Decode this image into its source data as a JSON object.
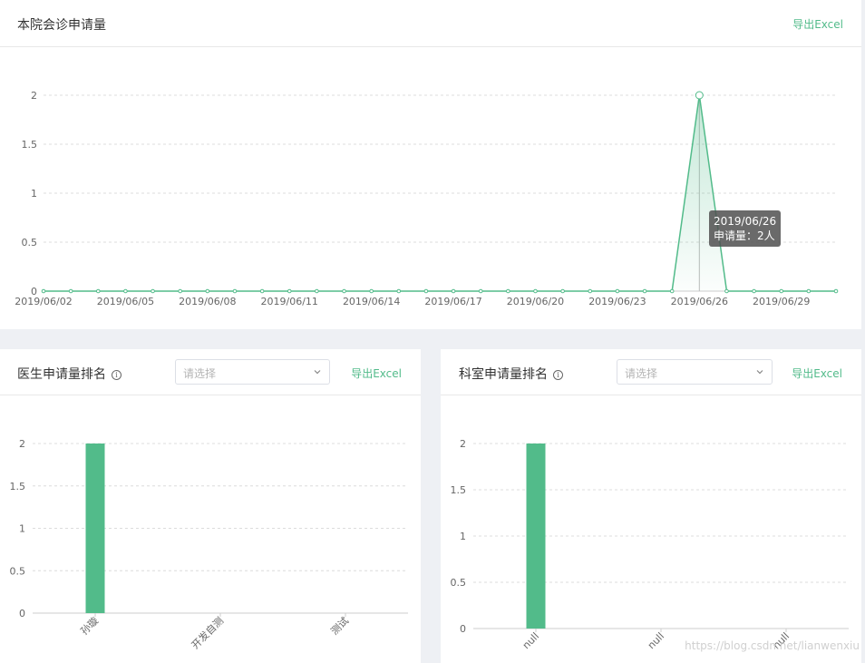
{
  "top": {
    "title": "本院会诊申请量",
    "export_label": "导出Excel",
    "tooltip": {
      "date": "2019/06/26",
      "line": "申请量：2人"
    }
  },
  "doctor": {
    "title": "医生申请量排名",
    "info_icon": "info-circle-icon",
    "select_placeholder": "请选择",
    "export_label": "导出Excel"
  },
  "dept": {
    "title": "科室申请量排名",
    "info_icon": "info-circle-icon",
    "select_placeholder": "请选择",
    "export_label": "导出Excel"
  },
  "watermark": "https://blog.csdn.net/lianwenxiu",
  "colors": {
    "accent": "#52bb8a",
    "bar": "#52bb8a"
  },
  "chart_data": [
    {
      "type": "area",
      "x": [
        "2019/06/02",
        "2019/06/03",
        "2019/06/04",
        "2019/06/05",
        "2019/06/06",
        "2019/06/07",
        "2019/06/08",
        "2019/06/09",
        "2019/06/10",
        "2019/06/11",
        "2019/06/12",
        "2019/06/13",
        "2019/06/14",
        "2019/06/15",
        "2019/06/16",
        "2019/06/17",
        "2019/06/18",
        "2019/06/19",
        "2019/06/20",
        "2019/06/21",
        "2019/06/22",
        "2019/06/23",
        "2019/06/24",
        "2019/06/25",
        "2019/06/26",
        "2019/06/27",
        "2019/06/28",
        "2019/06/29",
        "2019/06/30",
        "2019/07/01"
      ],
      "x_tick_labels": [
        "2019/06/02",
        "2019/06/05",
        "2019/06/08",
        "2019/06/11",
        "2019/06/14",
        "2019/06/17",
        "2019/06/20",
        "2019/06/23",
        "2019/06/26",
        "2019/06/29"
      ],
      "series": [
        {
          "values": [
            0,
            0,
            0,
            0,
            0,
            0,
            0,
            0,
            0,
            0,
            0,
            0,
            0,
            0,
            0,
            0,
            0,
            0,
            0,
            0,
            0,
            0,
            0,
            0,
            2,
            0,
            0,
            0,
            0,
            0
          ]
        }
      ],
      "y_ticks": [
        "0",
        "0.5",
        "1",
        "1.5",
        "2"
      ],
      "ylim": [
        0,
        2
      ],
      "grid": true
    },
    {
      "type": "bar",
      "categories": [
        "孙璇",
        "开发自测",
        "测试"
      ],
      "values": [
        2,
        0,
        0
      ],
      "y_ticks": [
        "0",
        "0.5",
        "1",
        "1.5",
        "2"
      ],
      "ylim": [
        0,
        2
      ],
      "grid": true
    },
    {
      "type": "bar",
      "categories": [
        "null",
        "null",
        "null"
      ],
      "values": [
        2,
        0,
        0
      ],
      "y_ticks": [
        "0",
        "0.5",
        "1",
        "1.5",
        "2"
      ],
      "ylim": [
        0,
        2
      ],
      "grid": true
    }
  ]
}
